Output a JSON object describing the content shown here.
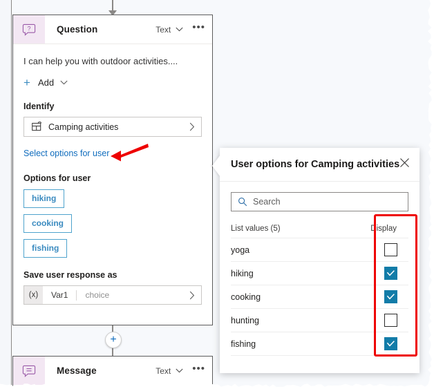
{
  "canvas": {
    "bg_color": "#f7f9fc"
  },
  "question_node": {
    "icon": "question-speech-bubble-icon",
    "title": "Question",
    "type_label": "Text",
    "type_chevron": "chevron-down-icon",
    "more_menu": "•••",
    "prompt": "I can help you with outdoor activities....",
    "add_label": "Add",
    "add_plus_icon": "plus-icon",
    "add_chevron": "chevron-down-icon",
    "identify_label": "Identify",
    "entity": {
      "icon": "entity-grid-icon",
      "name": "Camping activities",
      "chevron": "chevron-right-icon"
    },
    "select_options_link": "Select options for user",
    "options_label": "Options for user",
    "option_chips": [
      "hiking",
      "cooking",
      "fishing"
    ],
    "save_label": "Save user response as",
    "variable": {
      "prefix": "(x)",
      "name": "Var1",
      "type": "choice",
      "chevron": "chevron-right-icon"
    }
  },
  "connector": {
    "add_node_icon": "plus-icon"
  },
  "message_node": {
    "icon": "message-speech-bubble-icon",
    "title": "Message",
    "type_label": "Text",
    "type_chevron": "chevron-down-icon",
    "more_menu": "•••"
  },
  "options_panel": {
    "title": "User options for Camping activities",
    "close_icon": "close-icon",
    "search": {
      "icon": "search-icon",
      "placeholder": "Search"
    },
    "list_header": {
      "left": "List values (5)",
      "right": "Display"
    },
    "list_values": [
      {
        "name": "yoga",
        "display": false
      },
      {
        "name": "hiking",
        "display": true
      },
      {
        "name": "cooking",
        "display": true
      },
      {
        "name": "hunting",
        "display": false
      },
      {
        "name": "fishing",
        "display": true
      }
    ]
  },
  "annotations": {
    "arrow_color": "#ee0000",
    "rect_color": "#ee0000",
    "arrow_target": "Select options for user",
    "rect_target": "Display column"
  },
  "colors": {
    "accent_link": "#0f6cbd",
    "chip_border": "#4ea3cd",
    "chip_text": "#3b8bc0",
    "checkbox_on": "#127ca8",
    "node_icon_bg": "#f3e7f3",
    "node_icon_fg": "#8f4f9e"
  }
}
